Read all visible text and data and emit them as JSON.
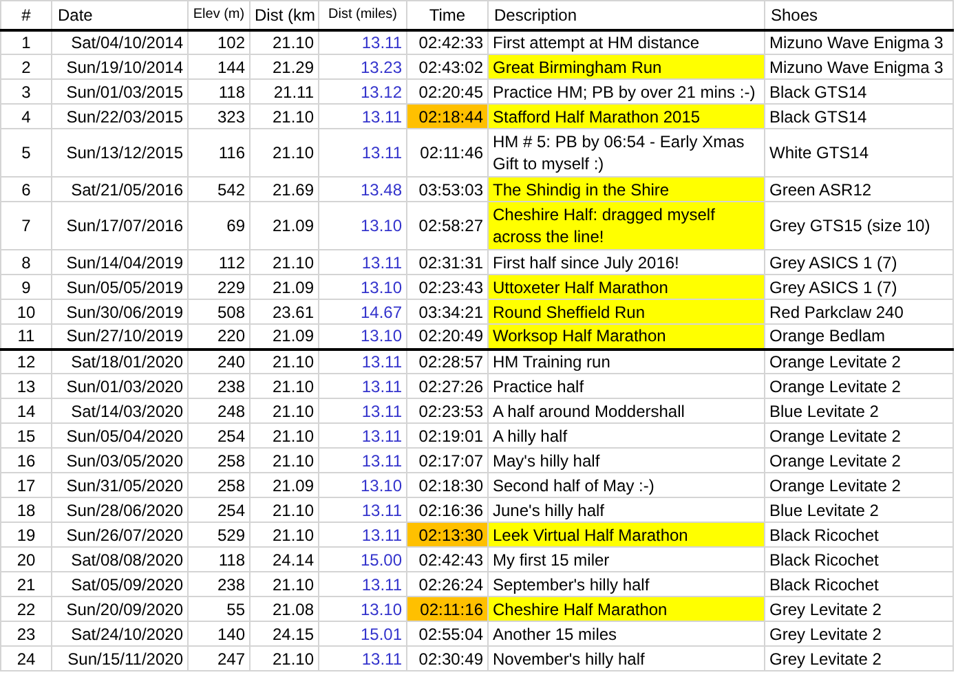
{
  "table": {
    "columns": [
      "#",
      "Date",
      "Elev (m)",
      "Dist (km",
      "Dist (miles)",
      "Time",
      "Description",
      "Shoes"
    ],
    "rows": [
      {
        "num": "1",
        "date": "Sat/04/10/2014",
        "elev": "102",
        "km": "21.10",
        "miles": "13.11",
        "time": "02:42:33",
        "description": "First attempt at HM distance",
        "shoes": "Mizuno Wave Enigma 3",
        "time_highlighted": false,
        "description_highlighted": false,
        "section_start": false
      },
      {
        "num": "2",
        "date": "Sun/19/10/2014",
        "elev": "144",
        "km": "21.29",
        "miles": "13.23",
        "time": "02:43:02",
        "description": "Great Birmingham Run",
        "shoes": "Mizuno Wave Enigma 3",
        "time_highlighted": false,
        "description_highlighted": true,
        "section_start": false
      },
      {
        "num": "3",
        "date": "Sun/01/03/2015",
        "elev": "118",
        "km": "21.11",
        "miles": "13.12",
        "time": "02:20:45",
        "description": "Practice HM; PB by over 21 mins :-)",
        "shoes": "Black GTS14",
        "time_highlighted": false,
        "description_highlighted": false,
        "section_start": false
      },
      {
        "num": "4",
        "date": "Sun/22/03/2015",
        "elev": "323",
        "km": "21.10",
        "miles": "13.11",
        "time": "02:18:44",
        "description": "Stafford Half Marathon 2015",
        "shoes": "Black GTS14",
        "time_highlighted": true,
        "description_highlighted": true,
        "section_start": false
      },
      {
        "num": "5",
        "date": "Sun/13/12/2015",
        "elev": "116",
        "km": "21.10",
        "miles": "13.11",
        "time": "02:11:46",
        "description": "HM # 5: PB by 06:54 - Early Xmas\nGift to myself :)",
        "shoes": "White GTS14",
        "time_highlighted": false,
        "description_highlighted": false,
        "section_start": false
      },
      {
        "num": "6",
        "date": "Sat/21/05/2016",
        "elev": "542",
        "km": "21.69",
        "miles": "13.48",
        "time": "03:53:03",
        "description": "The Shindig in the Shire",
        "shoes": "Green ASR12",
        "time_highlighted": false,
        "description_highlighted": true,
        "section_start": false
      },
      {
        "num": "7",
        "date": "Sun/17/07/2016",
        "elev": "69",
        "km": "21.09",
        "miles": "13.10",
        "time": "02:58:27",
        "description": "Cheshire Half: dragged myself\nacross the line!",
        "shoes": "Grey GTS15 (size 10)",
        "time_highlighted": false,
        "description_highlighted": true,
        "section_start": false
      },
      {
        "num": "8",
        "date": "Sun/14/04/2019",
        "elev": "112",
        "km": "21.10",
        "miles": "13.11",
        "time": "02:31:31",
        "description": "First half since July 2016!",
        "shoes": "Grey ASICS 1 (7)",
        "time_highlighted": false,
        "description_highlighted": false,
        "section_start": false
      },
      {
        "num": "9",
        "date": "Sun/05/05/2019",
        "elev": "229",
        "km": "21.09",
        "miles": "13.10",
        "time": "02:23:43",
        "description": "Uttoxeter Half Marathon",
        "shoes": "Grey ASICS 1 (7)",
        "time_highlighted": false,
        "description_highlighted": true,
        "section_start": false
      },
      {
        "num": "10",
        "date": "Sun/30/06/2019",
        "elev": "508",
        "km": "23.61",
        "miles": "14.67",
        "time": "03:34:21",
        "description": "Round Sheffield Run",
        "shoes": "Red Parkclaw 240",
        "time_highlighted": false,
        "description_highlighted": true,
        "section_start": false
      },
      {
        "num": "11",
        "date": "Sun/27/10/2019",
        "elev": "220",
        "km": "21.09",
        "miles": "13.10",
        "time": "02:20:49",
        "description": "Worksop Half Marathon",
        "shoes": "Orange Bedlam",
        "time_highlighted": false,
        "description_highlighted": true,
        "section_start": false
      },
      {
        "num": "12",
        "date": "Sat/18/01/2020",
        "elev": "240",
        "km": "21.10",
        "miles": "13.11",
        "time": "02:28:57",
        "description": "HM Training run",
        "shoes": "Orange Levitate 2",
        "time_highlighted": false,
        "description_highlighted": false,
        "section_start": true
      },
      {
        "num": "13",
        "date": "Sun/01/03/2020",
        "elev": "238",
        "km": "21.10",
        "miles": "13.11",
        "time": "02:27:26",
        "description": "Practice half",
        "shoes": "Orange Levitate 2",
        "time_highlighted": false,
        "description_highlighted": false,
        "section_start": false
      },
      {
        "num": "14",
        "date": "Sat/14/03/2020",
        "elev": "248",
        "km": "21.10",
        "miles": "13.11",
        "time": "02:23:53",
        "description": "A half around Moddershall",
        "shoes": "Blue Levitate 2",
        "time_highlighted": false,
        "description_highlighted": false,
        "section_start": false
      },
      {
        "num": "15",
        "date": "Sun/05/04/2020",
        "elev": "254",
        "km": "21.10",
        "miles": "13.11",
        "time": "02:19:01",
        "description": "A hilly half",
        "shoes": "Orange Levitate 2",
        "time_highlighted": false,
        "description_highlighted": false,
        "section_start": false
      },
      {
        "num": "16",
        "date": "Sun/03/05/2020",
        "elev": "258",
        "km": "21.10",
        "miles": "13.11",
        "time": "02:17:07",
        "description": "May's hilly half",
        "shoes": "Orange Levitate 2",
        "time_highlighted": false,
        "description_highlighted": false,
        "section_start": false
      },
      {
        "num": "17",
        "date": "Sun/31/05/2020",
        "elev": "258",
        "km": "21.09",
        "miles": "13.10",
        "time": "02:18:30",
        "description": "Second half of May :-)",
        "shoes": "Orange Levitate 2",
        "time_highlighted": false,
        "description_highlighted": false,
        "section_start": false
      },
      {
        "num": "18",
        "date": "Sun/28/06/2020",
        "elev": "254",
        "km": "21.10",
        "miles": "13.11",
        "time": "02:16:36",
        "description": "June's hilly half",
        "shoes": "Blue Levitate 2",
        "time_highlighted": false,
        "description_highlighted": false,
        "section_start": false
      },
      {
        "num": "19",
        "date": "Sun/26/07/2020",
        "elev": "529",
        "km": "21.10",
        "miles": "13.11",
        "time": "02:13:30",
        "description": "Leek Virtual Half Marathon",
        "shoes": "Black Ricochet",
        "time_highlighted": true,
        "description_highlighted": true,
        "section_start": false
      },
      {
        "num": "20",
        "date": "Sat/08/08/2020",
        "elev": "118",
        "km": "24.14",
        "miles": "15.00",
        "time": "02:42:43",
        "description": "My first 15 miler",
        "shoes": "Black Ricochet",
        "time_highlighted": false,
        "description_highlighted": false,
        "section_start": false
      },
      {
        "num": "21",
        "date": "Sat/05/09/2020",
        "elev": "238",
        "km": "21.10",
        "miles": "13.11",
        "time": "02:26:24",
        "description": "September's hilly half",
        "shoes": "Black Ricochet",
        "time_highlighted": false,
        "description_highlighted": false,
        "section_start": false
      },
      {
        "num": "22",
        "date": "Sun/20/09/2020",
        "elev": "55",
        "km": "21.08",
        "miles": "13.10",
        "time": "02:11:16",
        "description": "Cheshire Half Marathon",
        "shoes": "Grey Levitate 2",
        "time_highlighted": true,
        "description_highlighted": true,
        "section_start": false
      },
      {
        "num": "23",
        "date": "Sat/24/10/2020",
        "elev": "140",
        "km": "24.15",
        "miles": "15.01",
        "time": "02:55:04",
        "description": "Another 15 miles",
        "shoes": "Grey Levitate 2",
        "time_highlighted": false,
        "description_highlighted": false,
        "section_start": false
      },
      {
        "num": "24",
        "date": "Sun/15/11/2020",
        "elev": "247",
        "km": "21.10",
        "miles": "13.11",
        "time": "02:30:49",
        "description": "November's hilly half",
        "shoes": "Grey Levitate 2",
        "time_highlighted": false,
        "description_highlighted": false,
        "section_start": false
      }
    ]
  }
}
